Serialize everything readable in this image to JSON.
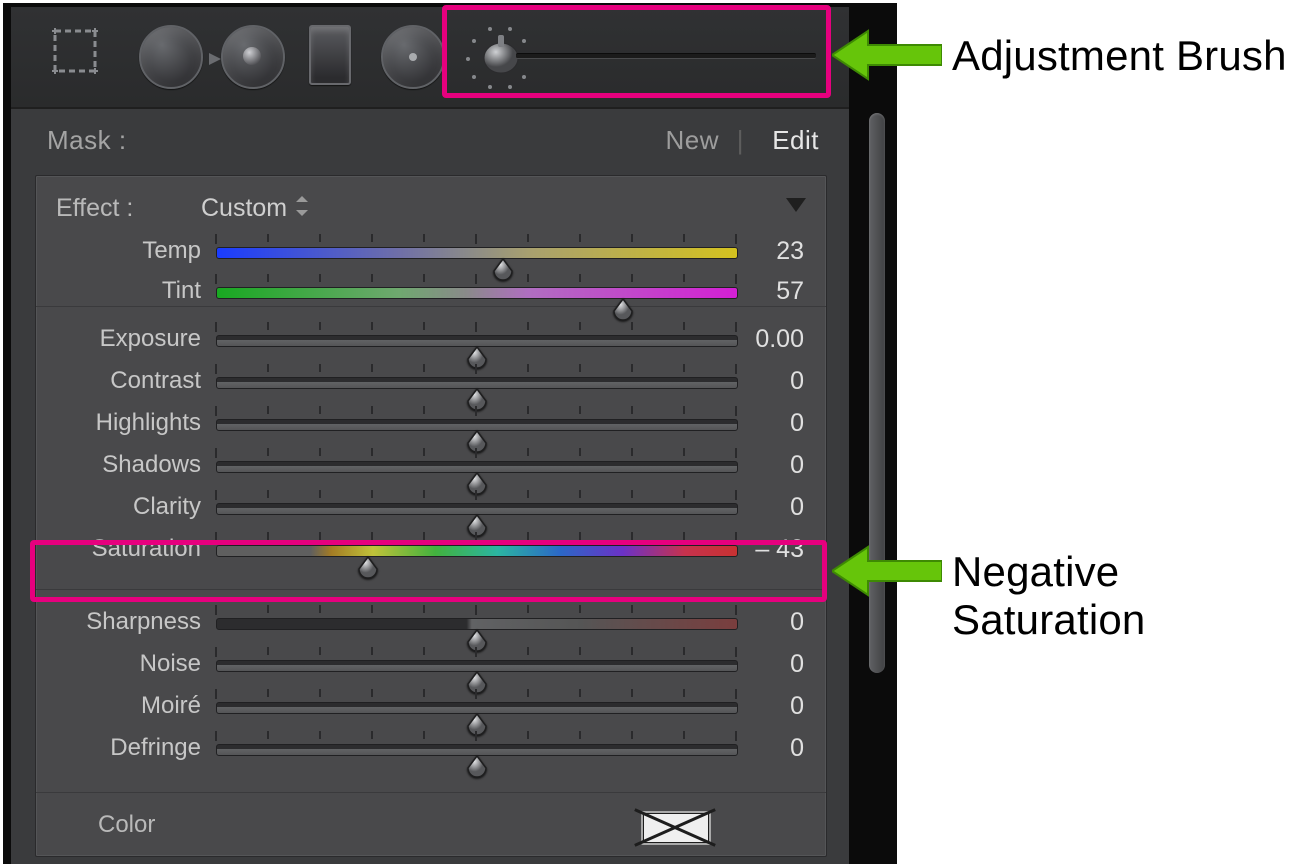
{
  "annotations": {
    "brush": "Adjustment Brush",
    "sat": "Negative Saturation"
  },
  "mask": {
    "label": "Mask :",
    "new": "New",
    "edit": "Edit"
  },
  "effect": {
    "label": "Effect :",
    "value": "Custom"
  },
  "color_label": "Color",
  "sliders": {
    "temp": {
      "label": "Temp",
      "value": "23",
      "pos": 0.55
    },
    "tint": {
      "label": "Tint",
      "value": "57",
      "pos": 0.78
    },
    "exposure": {
      "label": "Exposure",
      "value": "0.00",
      "pos": 0.5
    },
    "contrast": {
      "label": "Contrast",
      "value": "0",
      "pos": 0.5
    },
    "highlights": {
      "label": "Highlights",
      "value": "0",
      "pos": 0.5
    },
    "shadows": {
      "label": "Shadows",
      "value": "0",
      "pos": 0.5
    },
    "clarity": {
      "label": "Clarity",
      "value": "0",
      "pos": 0.5
    },
    "saturation": {
      "label": "Saturation",
      "value": "– 43",
      "pos": 0.29
    },
    "sharpness": {
      "label": "Sharpness",
      "value": "0",
      "pos": 0.5
    },
    "noise": {
      "label": "Noise",
      "value": "0",
      "pos": 0.5
    },
    "moire": {
      "label": "Moiré",
      "value": "0",
      "pos": 0.5
    },
    "defringe": {
      "label": "Defringe",
      "value": "0",
      "pos": 0.5
    }
  }
}
